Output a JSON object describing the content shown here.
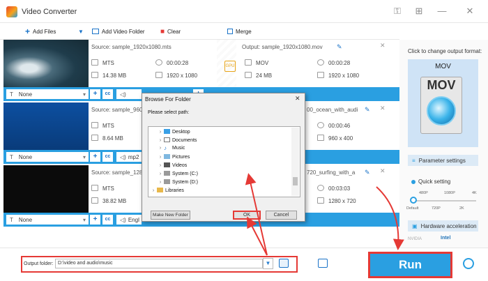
{
  "app": {
    "title": "Video Converter"
  },
  "toolbar": {
    "add_files": "Add Files",
    "add_video_folder": "Add Video Folder",
    "clear": "Clear",
    "merge": "Merge"
  },
  "files": [
    {
      "source": "Source: sample_1920x1080.mts",
      "output": "Output: sample_1920x1080.mov",
      "src_format": "MTS",
      "src_duration": "00:00:28",
      "src_size": "14.38 MB",
      "src_res": "1920 x 1080",
      "out_format": "MOV",
      "out_duration": "00:00:28",
      "out_size": "24 MB",
      "out_res": "1920 x 1080",
      "subtitle": "None",
      "gpu_label": "GPU"
    },
    {
      "source": "Source: sample_960",
      "output": "00_ocean_with_audi",
      "src_format": "MTS",
      "src_size": "8.64 MB",
      "out_duration": "00:00:46",
      "out_res": "960 x 400",
      "subtitle": "None",
      "audio": "mp2"
    },
    {
      "source": "Source: sample_1280",
      "output": "720_surfing_with_a",
      "src_format": "MTS",
      "src_size": "38.82 MB",
      "out_duration": "00:03:03",
      "out_res": "1280 x 720",
      "subtitle": "None",
      "audio": "Engl"
    }
  ],
  "right_panel": {
    "click_label": "Click to change output format:",
    "format": "MOV",
    "format_icon_text": "MOV",
    "parameter_settings": "Parameter settings",
    "quick_setting": "Quick setting",
    "ticks_top": [
      "480P",
      "1080P",
      "4K"
    ],
    "ticks_bottom": [
      "Default",
      "720P",
      "2K"
    ],
    "hardware_acceleration": "Hardware acceleration",
    "nvidia": "NVIDIA",
    "intel": "Intel"
  },
  "bottom": {
    "output_label": "Output folder:",
    "output_path": "D:\\video and audio\\music",
    "run": "Run"
  },
  "dialog": {
    "title": "Browse For Folder",
    "prompt": "Please select path:",
    "tree": [
      "Desktop",
      "Documents",
      "Music",
      "Pictures",
      "Videos",
      "System (C:)",
      "System (D:)",
      "Libraries"
    ],
    "new_folder": "Make New Folder",
    "ok": "OK",
    "cancel": "Cancel"
  },
  "colors": {
    "accent": "#2a9fe1",
    "highlight": "#e53935"
  }
}
